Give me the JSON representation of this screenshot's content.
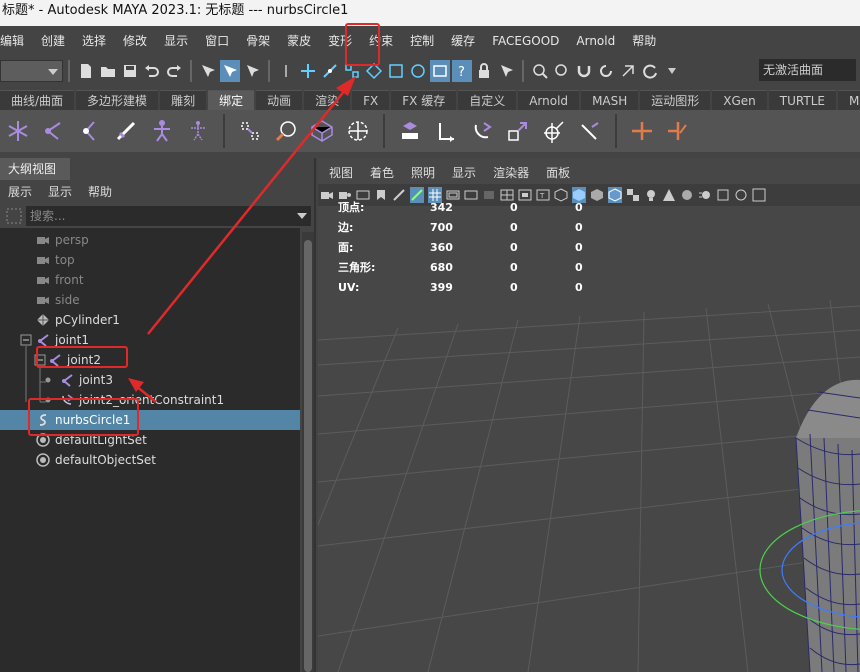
{
  "window": {
    "title": "标题* - Autodesk MAYA 2023.1: 无标题   ---   nurbsCircle1"
  },
  "menubar": {
    "items": [
      "编辑",
      "创建",
      "选择",
      "修改",
      "显示",
      "窗口",
      "骨架",
      "蒙皮",
      "变形",
      "约束",
      "控制",
      "缓存",
      "FACEGOOD",
      "Arnold",
      "帮助"
    ]
  },
  "toolbar": {
    "curve_field": "无激活曲面"
  },
  "shelf_tabs": {
    "items": [
      "曲线/曲面",
      "多边形建模",
      "雕刻",
      "绑定",
      "动画",
      "渲染",
      "FX",
      "FX 缓存",
      "自定义",
      "Arnold",
      "MASH",
      "运动图形",
      "XGen",
      "TURTLE",
      "MSP"
    ],
    "active_index": 3
  },
  "outliner": {
    "title": "大纲视图",
    "menu": [
      "展示",
      "显示",
      "帮助"
    ],
    "search_placeholder": "搜索...",
    "items": [
      "persp",
      "top",
      "front",
      "side",
      "pCylinder1",
      "joint1",
      "joint2",
      "joint3",
      "joint2_orientConstraint1",
      "nurbsCircle1",
      "defaultLightSet",
      "defaultObjectSet"
    ],
    "selected": "nurbsCircle1"
  },
  "viewport": {
    "menu": [
      "视图",
      "着色",
      "照明",
      "显示",
      "渲染器",
      "面板"
    ],
    "hud": {
      "rows": [
        {
          "label": "顶点:",
          "v1": "342",
          "v2": "0",
          "v3": "0"
        },
        {
          "label": "边:",
          "v1": "700",
          "v2": "0",
          "v3": "0"
        },
        {
          "label": "面:",
          "v1": "360",
          "v2": "0",
          "v3": "0"
        },
        {
          "label": "三角形:",
          "v1": "680",
          "v2": "0",
          "v3": "0"
        },
        {
          "label": "UV:",
          "v1": "399",
          "v2": "0",
          "v3": "0"
        }
      ]
    }
  },
  "colors": {
    "selection": "#5285a6",
    "annotation": "#e02a2a",
    "joint": "#a98be0",
    "constraint": "#e07b4a"
  }
}
